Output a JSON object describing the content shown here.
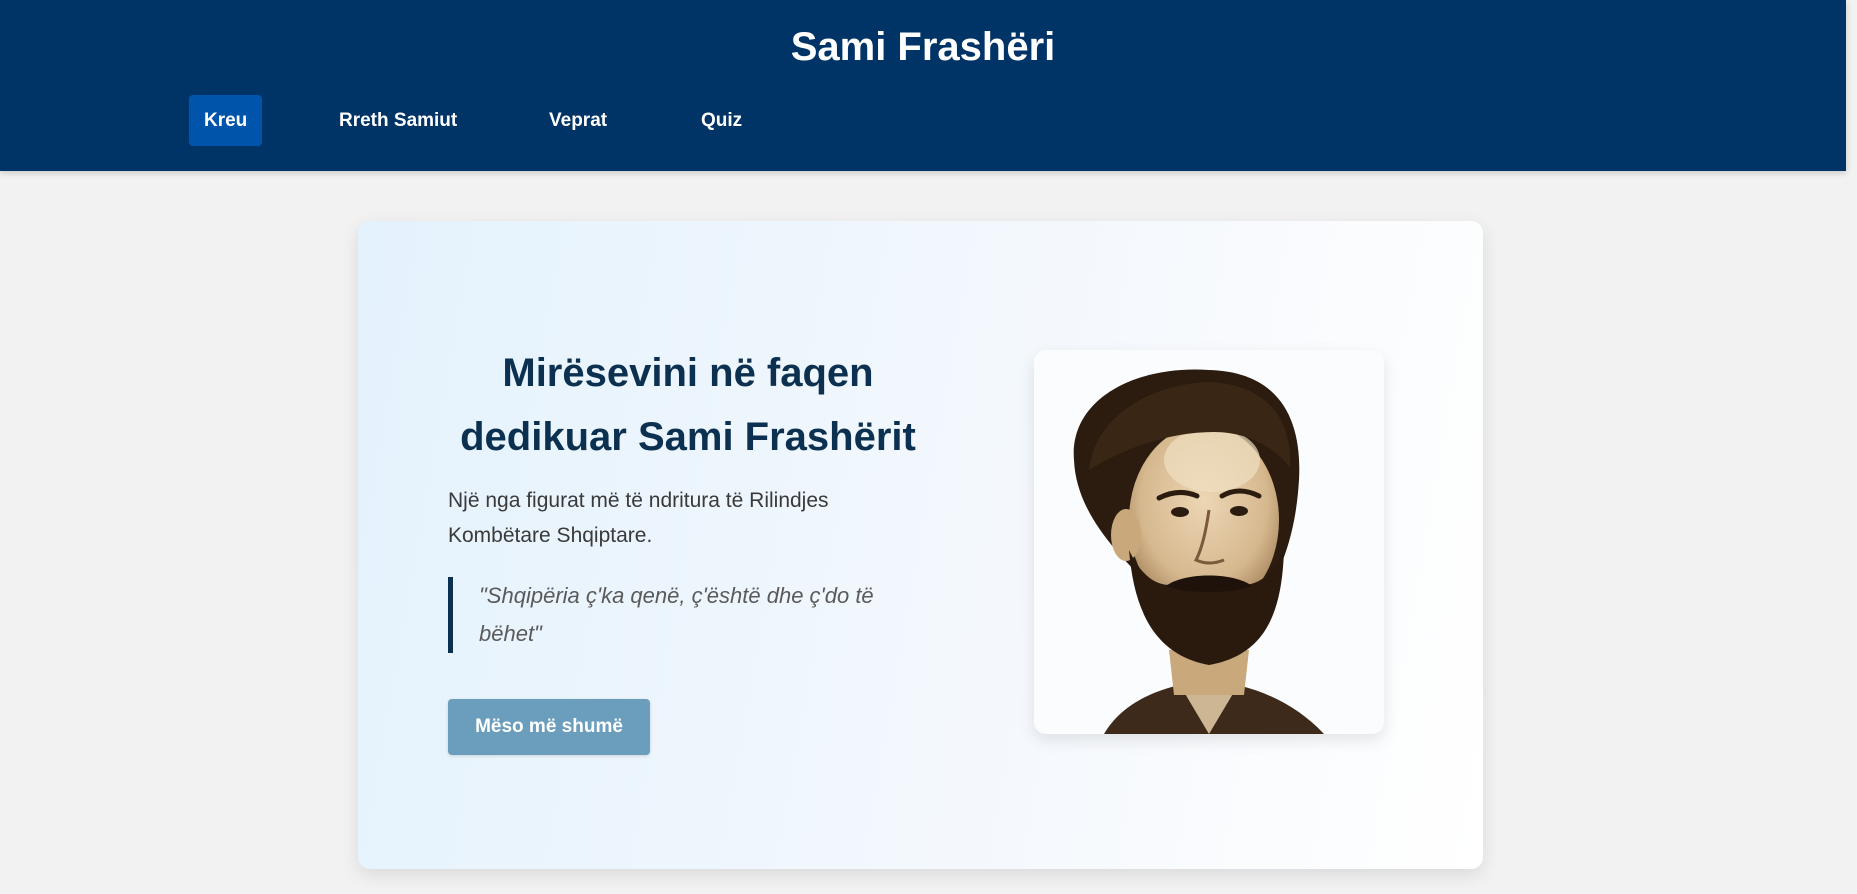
{
  "header": {
    "title": "Sami Frashëri",
    "nav": [
      {
        "label": "Kreu",
        "active": true
      },
      {
        "label": "Rreth Samiut",
        "active": false
      },
      {
        "label": "Veprat",
        "active": false
      },
      {
        "label": "Quiz",
        "active": false
      }
    ]
  },
  "hero": {
    "title": "Mirësevini në faqen dedikuar Sami Frashërit",
    "subtitle": "Një nga figurat më të ndritura të Rilindjes Kombëtare Shqiptare.",
    "quote": "\"Shqipëria ç'ka qenë, ç'është dhe ç'do të bëhet\"",
    "button_label": "Mëso më shumë"
  },
  "colors": {
    "header_bg": "#003366",
    "nav_active_bg": "#0055aa",
    "title_text": "#0b3050",
    "button_bg": "#6a9ebc",
    "page_bg": "#f2f2f2"
  },
  "icons": {
    "portrait": "sami-frasheri-portrait"
  }
}
